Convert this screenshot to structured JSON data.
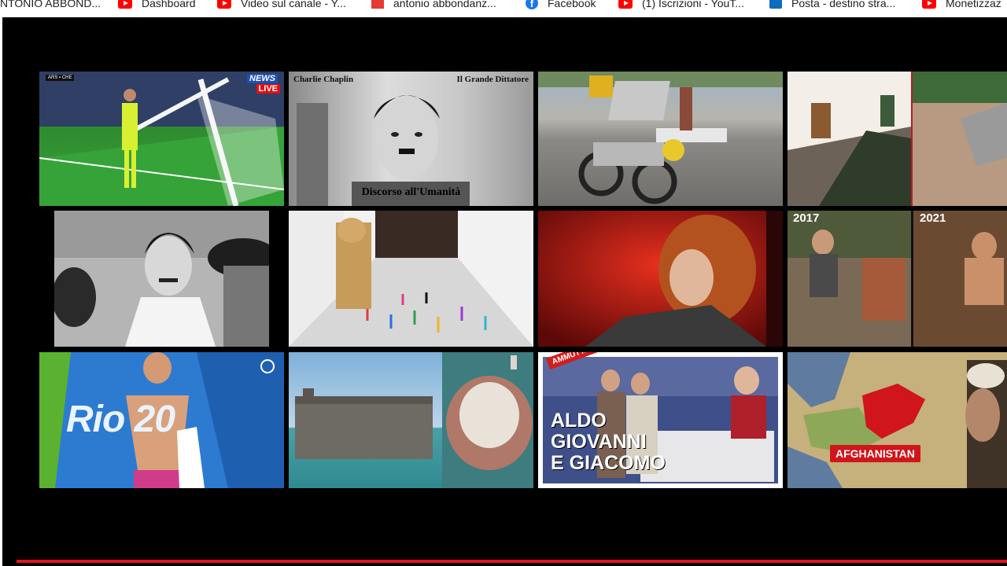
{
  "bookmarks": [
    {
      "label": "NTONIO ABBOND...",
      "icon": "none"
    },
    {
      "label": "Dashboard",
      "icon": "youtube-icon"
    },
    {
      "label": "Video sul canale - Y...",
      "icon": "youtube-icon"
    },
    {
      "label": "antonio abbondanz...",
      "icon": "analytics-icon"
    },
    {
      "label": "Facebook",
      "icon": "facebook-icon"
    },
    {
      "label": "(1) Iscrizioni - YouT...",
      "icon": "youtube-icon"
    },
    {
      "label": "Posta - destino stra...",
      "icon": "outlook-icon"
    },
    {
      "label": "Monetizzaz",
      "icon": "youtube-icon"
    }
  ],
  "thumbnails": {
    "t1": {
      "badge_top": "NEWS",
      "badge_live": "LIVE",
      "score_left": "ARS",
      "score_right": "CHE"
    },
    "t2": {
      "top_left": "Charlie Chaplin",
      "top_right": "Il Grande Dittatore",
      "bottom": "Discorso all'Umanità"
    },
    "t8": {
      "year_left": "2017",
      "year_right": "2021"
    },
    "t9": {
      "logo_text": "Rio 20"
    },
    "t11": {
      "ribbon": "AMMUTTA MUDDICA",
      "line1": "ALDO",
      "line2": "GIOVANNI",
      "line3": "E GIACOMO"
    },
    "t12": {
      "label": "AFGHANISTAN"
    }
  },
  "colors": {
    "player_bg": "#000000",
    "progress": "#e4141b",
    "yt_red": "#ff0000"
  }
}
